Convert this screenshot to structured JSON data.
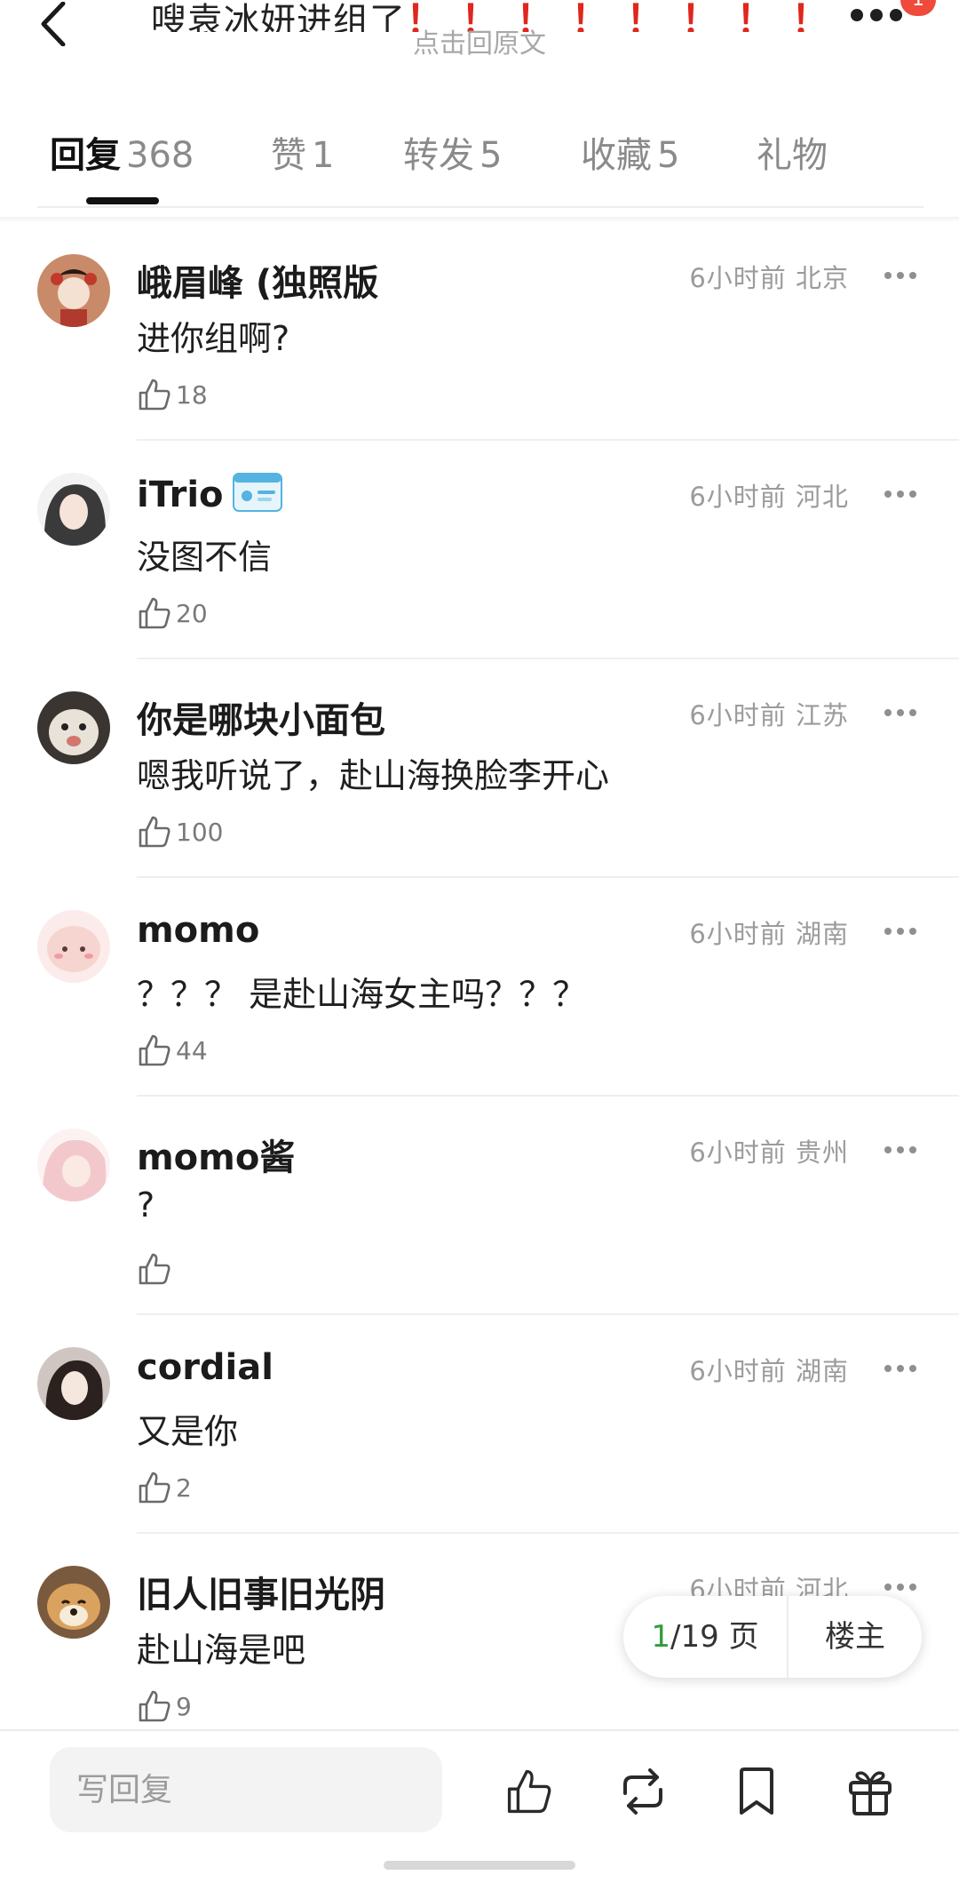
{
  "header": {
    "title": "嗖袁冰妍进组了",
    "title_marks": "！！！！！！！！！",
    "title_ellipsis": "…",
    "subtitle": "点击回原文",
    "badge": "1"
  },
  "tabs": [
    {
      "label": "回复",
      "count": "368"
    },
    {
      "label": "赞",
      "count": "1"
    },
    {
      "label": "转发",
      "count": "5"
    },
    {
      "label": "收藏",
      "count": "5"
    },
    {
      "label": "礼物",
      "count": ""
    }
  ],
  "comments": [
    {
      "user": "峨眉峰 (独照版",
      "meta": "6小时前 北京",
      "text": "进你组啊?",
      "likes": "18",
      "avatar_color": "#c98a6a"
    },
    {
      "user": "iTrio",
      "meta": "6小时前 河北",
      "text": "没图不信",
      "likes": "20",
      "avatar_color": "#3a3a3a"
    },
    {
      "user": "你是哪块小面包",
      "meta": "6小时前 江苏",
      "text": "嗯我听说了，赴山海换脸李开心",
      "likes": "100",
      "avatar_color": "#e8e2d8"
    },
    {
      "user": "momo",
      "meta": "6小时前 湖南",
      "text": "？？？ 是赴山海女主吗？？？",
      "likes": "44",
      "avatar_color": "#f6d5d0"
    },
    {
      "user": "momo酱",
      "meta": "6小时前 贵州",
      "text": "?",
      "likes": "",
      "avatar_color": "#f3c8cc"
    },
    {
      "user": "cordial",
      "meta": "6小时前 湖南",
      "text": "又是你",
      "likes": "2",
      "avatar_color": "#cfc6c2"
    },
    {
      "user": "旧人旧事旧光阴",
      "meta": "6小时前 河北",
      "text": "赴山海是吧",
      "likes": "9",
      "avatar_color": "#d9a25e"
    }
  ],
  "pager": {
    "current": "1",
    "total_label": "/19 页",
    "owner_label": "楼主"
  },
  "bottom_bar": {
    "reply_placeholder": "写回复"
  },
  "colors": {
    "accent_green": "#2f9c3d",
    "title_excl_red": "#e0261d",
    "badge_red": "#f04a3a"
  }
}
